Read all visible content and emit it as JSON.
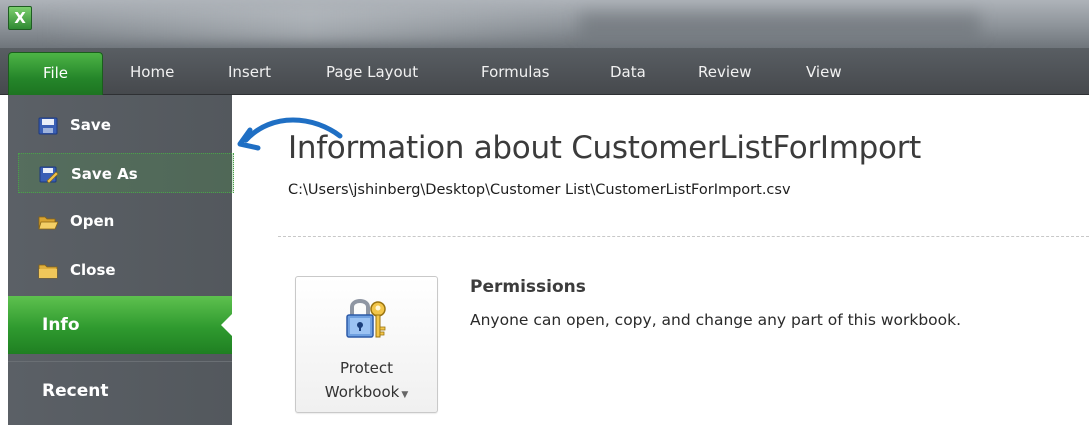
{
  "ribbon": {
    "file_tab": "File",
    "tabs": [
      "Home",
      "Insert",
      "Page Layout",
      "Formulas",
      "Data",
      "Review",
      "View"
    ]
  },
  "app_icon_letter": "X",
  "backstage_nav": {
    "commands": [
      {
        "label": "Save",
        "icon": "save-icon"
      },
      {
        "label": "Save As",
        "icon": "save-as-icon"
      },
      {
        "label": "Open",
        "icon": "open-folder-icon"
      },
      {
        "label": "Close",
        "icon": "close-folder-icon"
      }
    ],
    "info": "Info",
    "recent": "Recent"
  },
  "info": {
    "title": "Information about CustomerListForImport",
    "path": "C:\\Users\\jshinberg\\Desktop\\Customer List\\CustomerListForImport.csv"
  },
  "permissions": {
    "button_line1": "Protect",
    "button_line2": "Workbook",
    "heading": "Permissions",
    "description": "Anyone can open, copy, and change any part of this workbook."
  },
  "colors": {
    "accent_green": "#2f9a2f",
    "nav_gray": "#585d62",
    "annotation_arrow": "#1f6fc4"
  }
}
